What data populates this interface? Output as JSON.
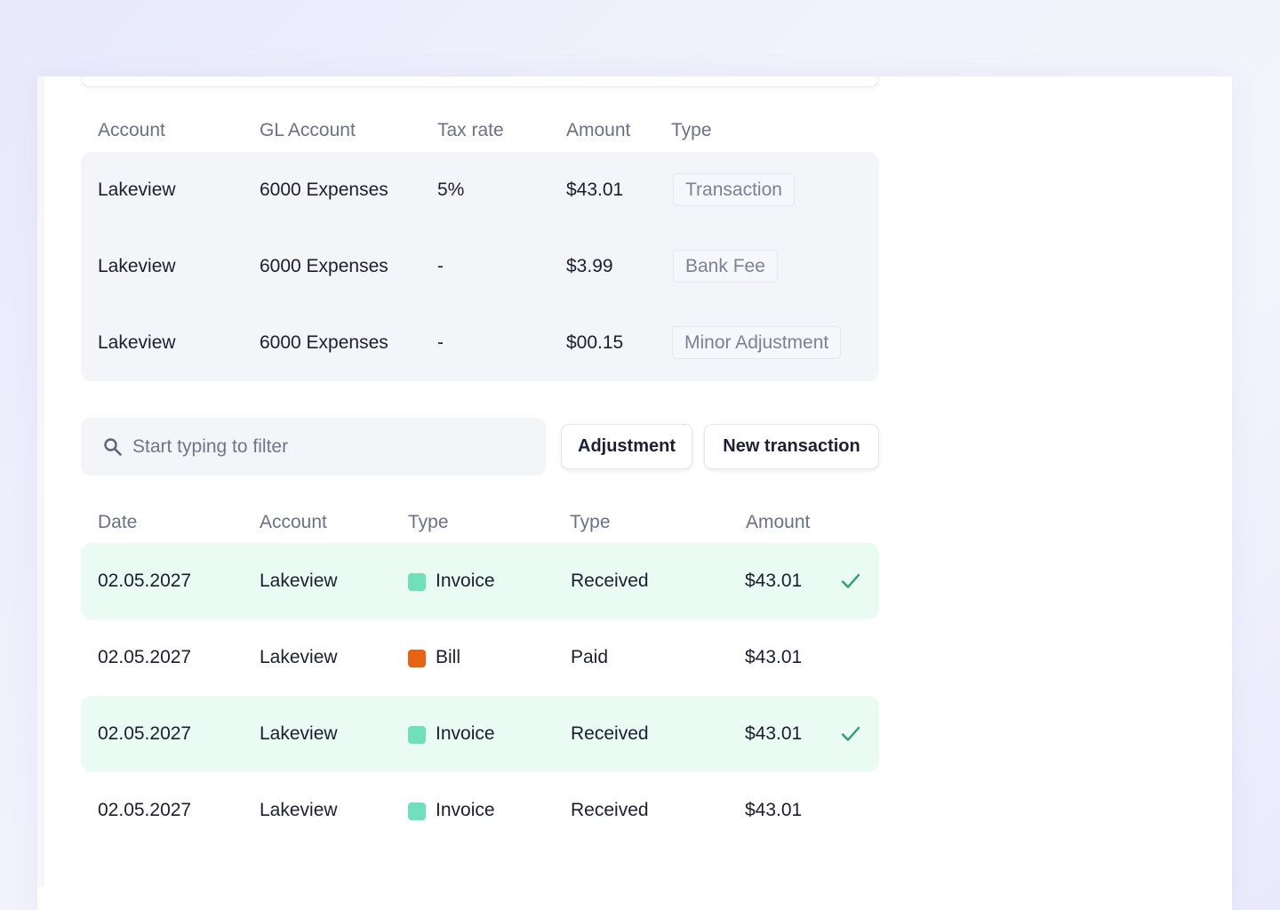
{
  "splits": {
    "headers": [
      "Account",
      "GL Account",
      "Tax rate",
      "Amount",
      "Type"
    ],
    "rows": [
      {
        "account": "Lakeview",
        "gl_account": "6000 Expenses",
        "tax_rate": "5%",
        "amount": "$43.01",
        "type": "Transaction"
      },
      {
        "account": "Lakeview",
        "gl_account": "6000 Expenses",
        "tax_rate": "-",
        "amount": "$3.99",
        "type": "Bank Fee"
      },
      {
        "account": "Lakeview",
        "gl_account": "6000 Expenses",
        "tax_rate": "-",
        "amount": "$00.15",
        "type": "Minor Adjustment"
      }
    ]
  },
  "filter": {
    "placeholder": "Start typing to filter",
    "icon": "search-icon"
  },
  "actions": {
    "adjustment_label": "Adjustment",
    "new_transaction_label": "New transaction"
  },
  "transactions": {
    "headers": [
      "Date",
      "Account",
      "Type",
      "Type",
      "Amount"
    ],
    "rows": [
      {
        "date": "02.05.2027",
        "account": "Lakeview",
        "kind": "Invoice",
        "status": "Received",
        "amount": "$43.01",
        "matched": true,
        "color": "#6fe0bb"
      },
      {
        "date": "02.05.2027",
        "account": "Lakeview",
        "kind": "Bill",
        "status": "Paid",
        "amount": "$43.01",
        "matched": false,
        "color": "#e8620f"
      },
      {
        "date": "02.05.2027",
        "account": "Lakeview",
        "kind": "Invoice",
        "status": "Received",
        "amount": "$43.01",
        "matched": true,
        "color": "#6fe0bb"
      },
      {
        "date": "02.05.2027",
        "account": "Lakeview",
        "kind": "Invoice",
        "status": "Received",
        "amount": "$43.01",
        "matched": false,
        "color": "#6fe0bb"
      }
    ]
  },
  "colors": {
    "match_highlight": "#e9fbf3",
    "check": "#23a06e",
    "invoice": "#6fe0bb",
    "bill": "#e8620f"
  }
}
